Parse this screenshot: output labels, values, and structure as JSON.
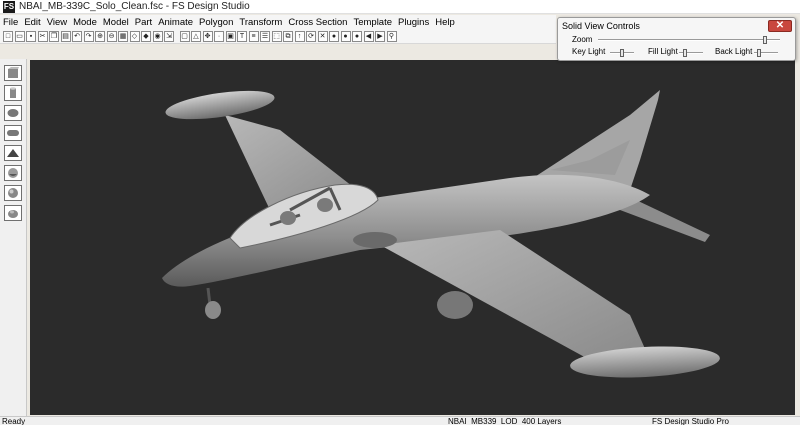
{
  "window": {
    "icon_label": "FS",
    "title": "NBAI_MB-339C_Solo_Clean.fsc - FS Design Studio"
  },
  "menu": [
    "File",
    "Edit",
    "View",
    "Mode",
    "Model",
    "Part",
    "Animate",
    "Polygon",
    "Transform",
    "Cross Section",
    "Template",
    "Plugins",
    "Help"
  ],
  "toolbar": {
    "buttons": [
      {
        "name": "new-file-icon",
        "glyph": "□"
      },
      {
        "name": "open-file-icon",
        "glyph": "▭"
      },
      {
        "name": "save-icon",
        "glyph": "▪"
      },
      {
        "name": "cut-icon",
        "glyph": "✂"
      },
      {
        "name": "copy-icon",
        "glyph": "❐"
      },
      {
        "name": "paste-icon",
        "glyph": "▤"
      },
      {
        "name": "undo-icon",
        "glyph": "↶"
      },
      {
        "name": "redo-icon",
        "glyph": "↷"
      },
      {
        "name": "zoom-in-icon",
        "glyph": "⊕"
      },
      {
        "name": "zoom-out-icon",
        "glyph": "⊖"
      },
      {
        "name": "grid-icon",
        "glyph": "▦"
      },
      {
        "name": "wireframe-icon",
        "glyph": "◇"
      },
      {
        "name": "solid-view-icon",
        "glyph": "◆"
      },
      {
        "name": "camera-icon",
        "glyph": "◉"
      },
      {
        "name": "export-icon",
        "glyph": "⇲"
      }
    ],
    "buttons2": [
      {
        "name": "select-icon",
        "glyph": "▢"
      },
      {
        "name": "triangle-icon",
        "glyph": "△"
      },
      {
        "name": "move-icon",
        "glyph": "✥"
      },
      {
        "name": "point-icon",
        "glyph": "·"
      },
      {
        "name": "scale-icon",
        "glyph": "▣"
      },
      {
        "name": "text-icon",
        "glyph": "T"
      },
      {
        "name": "list-icon",
        "glyph": "≡"
      },
      {
        "name": "align-icon",
        "glyph": "☰"
      },
      {
        "name": "frame-icon",
        "glyph": "⬚"
      },
      {
        "name": "group-icon",
        "glyph": "⧉"
      },
      {
        "name": "arrow-up-icon",
        "glyph": "↑"
      },
      {
        "name": "rotate-icon",
        "glyph": "⟳"
      },
      {
        "name": "delete-icon",
        "glyph": "✕"
      },
      {
        "name": "material-red-icon",
        "glyph": "●"
      },
      {
        "name": "material-green-icon",
        "glyph": "●"
      },
      {
        "name": "texture-icon",
        "glyph": "●"
      },
      {
        "name": "play-back-icon",
        "glyph": "◀"
      },
      {
        "name": "play-forward-icon",
        "glyph": "▶"
      },
      {
        "name": "binoculars-icon",
        "glyph": "⚲"
      }
    ]
  },
  "solid_view_controls": {
    "title": "Solid View Controls",
    "close_glyph": "✕",
    "zoom_label": "Zoom",
    "key_light_label": "Key Light",
    "fill_light_label": "Fill Light",
    "back_light_label": "Back Light",
    "zoom_level": 0.92,
    "key_light_level": 0.5,
    "fill_light_level": 0.25,
    "back_light_level": 0.2
  },
  "status": {
    "ready": "Ready",
    "model": "NBAI_MB339_LOD_400 Layers",
    "app": "FS Design Studio Pro"
  },
  "colors": {
    "viewport_bg": "#2b2b2b",
    "model_body": "#9a9a9a",
    "close_button": "#c9473e"
  }
}
